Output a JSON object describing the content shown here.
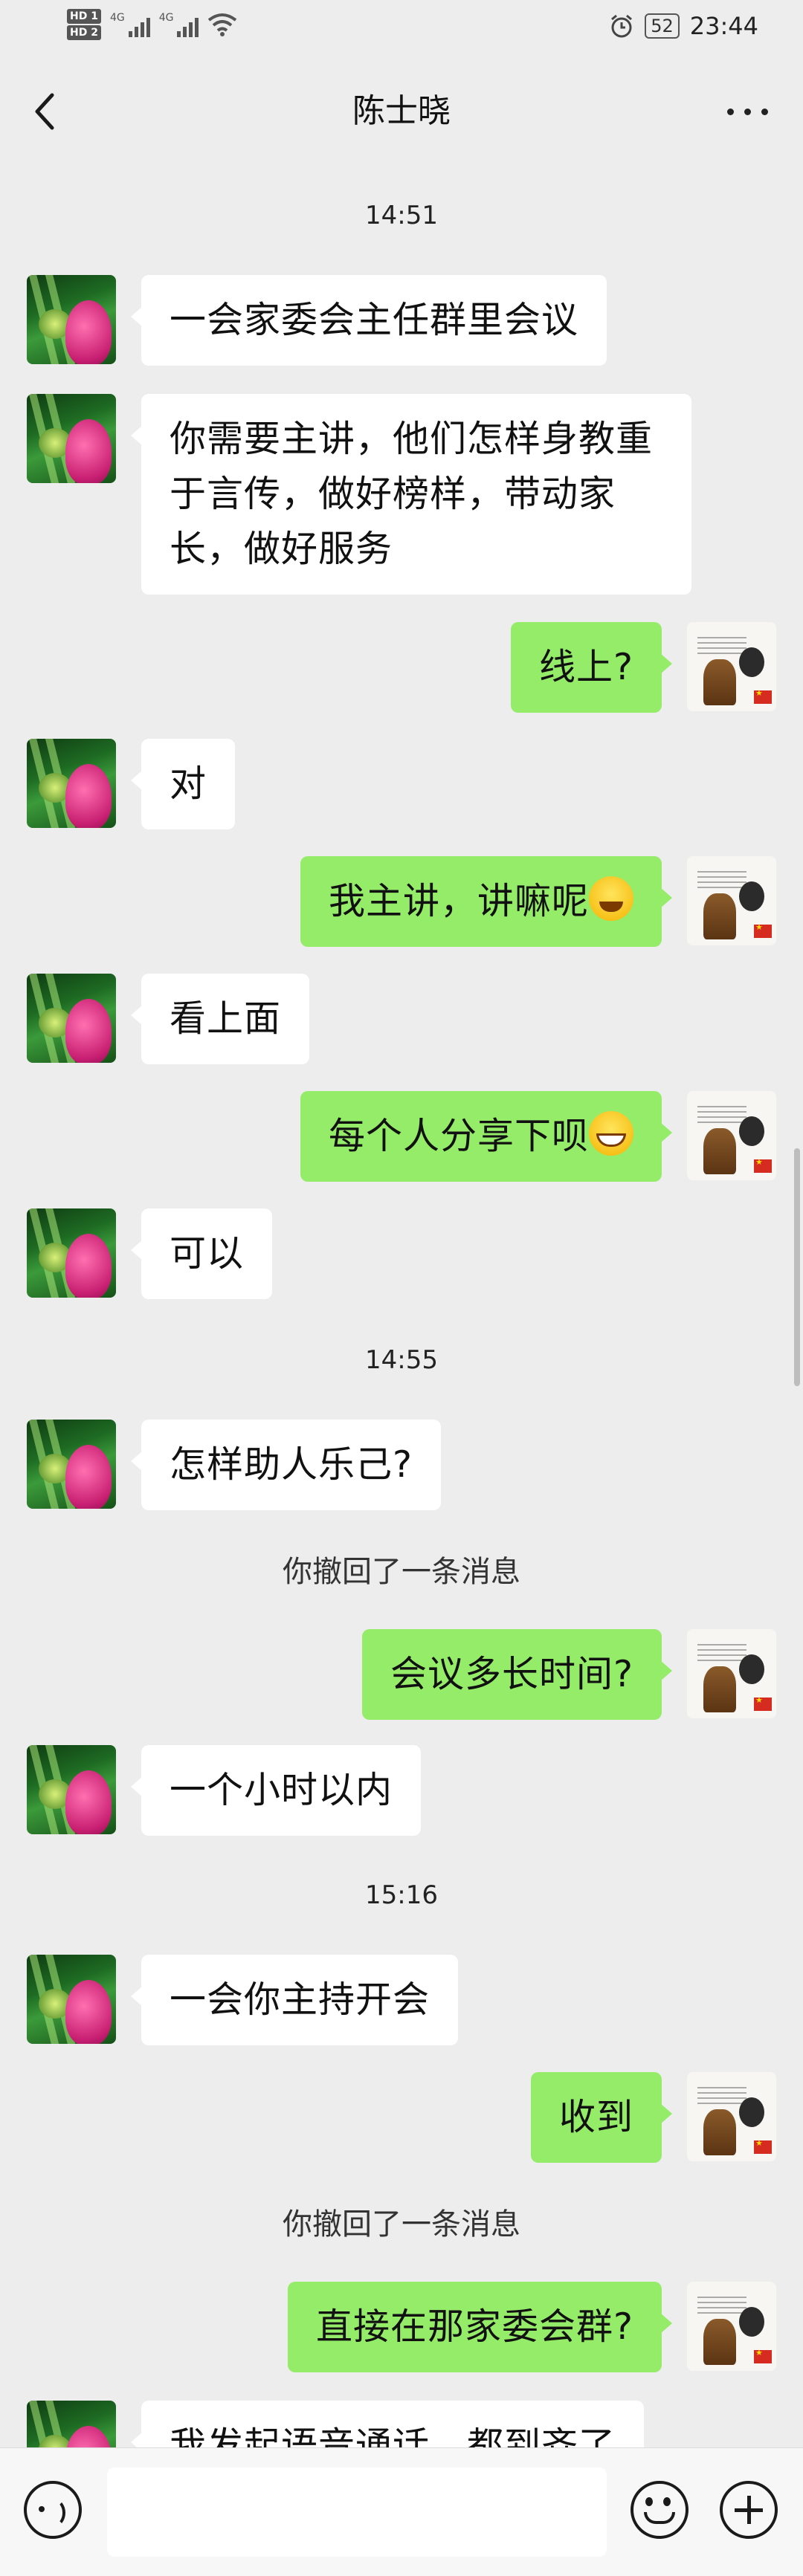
{
  "status_bar": {
    "hd1": "HD 1",
    "hd2": "HD 2",
    "net1": "4G",
    "net2": "4G",
    "battery": "52",
    "time": "23:44"
  },
  "header": {
    "title": "陈士晓"
  },
  "messages": [
    {
      "type": "time",
      "text": "14:51"
    },
    {
      "type": "in",
      "text": "一会家委会主任群里会议"
    },
    {
      "type": "in",
      "text": "你需要主讲，他们怎样身教重于言传，做好榜样，带动家长，做好服务"
    },
    {
      "type": "out",
      "text": "线上?"
    },
    {
      "type": "in",
      "text": "对"
    },
    {
      "type": "out",
      "text": "我主讲，讲嘛呢",
      "emoji": "cry"
    },
    {
      "type": "in",
      "text": "看上面"
    },
    {
      "type": "out",
      "text": "每个人分享下呗",
      "emoji": "grin"
    },
    {
      "type": "in",
      "text": "可以"
    },
    {
      "type": "time",
      "text": "14:55"
    },
    {
      "type": "in",
      "text": "怎样助人乐己?"
    },
    {
      "type": "system",
      "text": "你撤回了一条消息"
    },
    {
      "type": "out",
      "text": "会议多长时间?"
    },
    {
      "type": "in",
      "text": "一个小时以内"
    },
    {
      "type": "time",
      "text": "15:16"
    },
    {
      "type": "in",
      "text": "一会你主持开会"
    },
    {
      "type": "out",
      "text": "收到"
    },
    {
      "type": "system",
      "text": "你撤回了一条消息"
    },
    {
      "type": "out",
      "text": "直接在那家委会群?"
    },
    {
      "type": "in",
      "text": "我发起语音通话，都到齐了"
    }
  ]
}
